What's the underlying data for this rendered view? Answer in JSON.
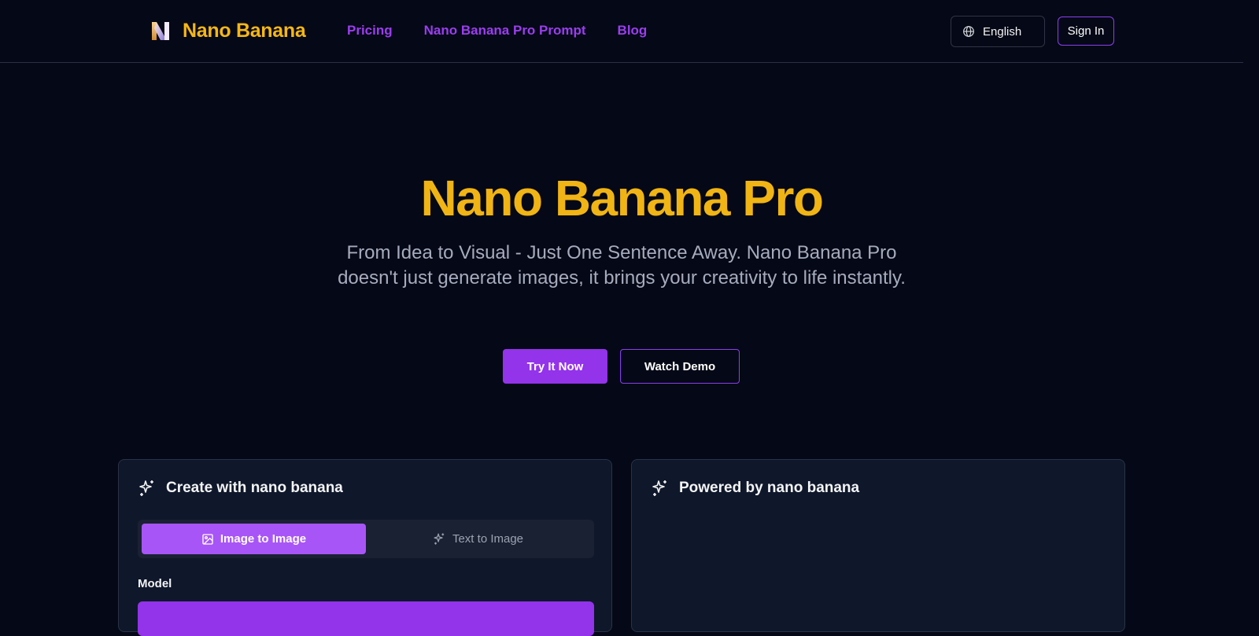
{
  "brand": {
    "name": "Nano Banana",
    "accent_color": "#f5b716",
    "primary_color": "#9333ea"
  },
  "nav": {
    "links": [
      "Pricing",
      "Nano Banana Pro Prompt",
      "Blog"
    ]
  },
  "header": {
    "language": "English",
    "sign_in": "Sign In"
  },
  "hero": {
    "title": "Nano Banana Pro",
    "subtitle": "From Idea to Visual - Just One Sentence Away. Nano Banana Pro doesn't just generate images, it brings your creativity to life instantly.",
    "primary_cta": "Try It Now",
    "secondary_cta": "Watch Demo"
  },
  "create_card": {
    "title": "Create with nano banana",
    "icon": "sparkles-icon",
    "tabs": [
      {
        "label": "Image to Image",
        "icon": "image-icon",
        "active": true
      },
      {
        "label": "Text to Image",
        "icon": "sparkles-icon",
        "active": false
      }
    ],
    "model_label": "Model"
  },
  "output_card": {
    "title": "Powered by nano banana",
    "icon": "sparkles-icon"
  }
}
